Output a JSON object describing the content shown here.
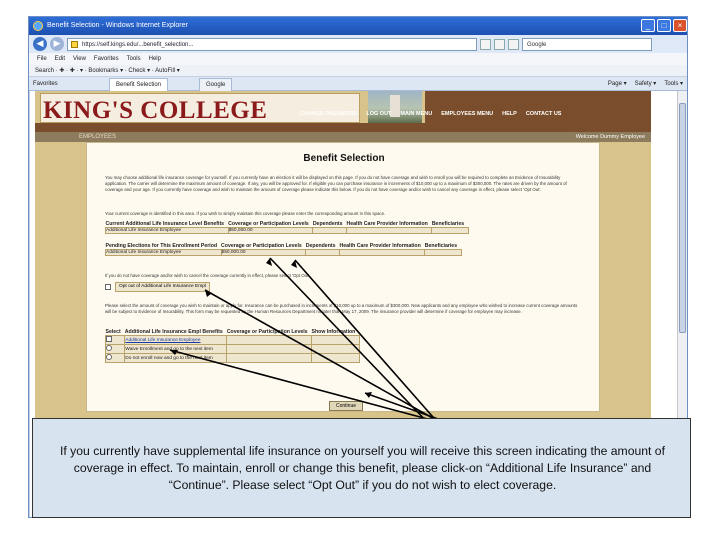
{
  "browser": {
    "title": "Benefit Selection - Windows Internet Explorer",
    "url": "https://self.kings.edu/...benefit_selection...",
    "search_placeholder": "Google",
    "menu": [
      "File",
      "Edit",
      "View",
      "Favorites",
      "Tools",
      "Help"
    ],
    "links_bar": "Search · ✚ · ✚ · ▾ · Bookmarks ▾ · Check ▾ · AutoFill ▾",
    "favorites_label": "Favorites",
    "tabs": [
      "Benefit Selection",
      "Google"
    ],
    "tool_items": [
      "Page ▾",
      "Safety ▾",
      "Tools ▾"
    ]
  },
  "site": {
    "logo": "KING'S COLLEGE",
    "nav": [
      "CHANGE PASSWORD",
      "LOG OUT",
      "MAIN MENU",
      "EMPLOYEES MENU",
      "HELP",
      "CONTACT US"
    ],
    "section": "EMPLOYEES",
    "welcome": "Welcome Dummy Employee"
  },
  "page": {
    "title": "Benefit Selection",
    "intro": "You may choose additional life insurance coverage for yourself. If you currently have an election it will be displayed on this page. If you do not have coverage and wish to enroll you will be required to complete an Evidence of Insurability application. The carrier will determine the maximum amount of coverage. If any, you will be approved for. If eligible you can purchase insurance in increments of $10,000 up to a maximum of $300,000. The rates are driven by the amount of coverage and your age. If you currently have coverage and wish to maintain the amount of coverage please indicate this below. If you do not have coverage and/or wish to cancel any coverage in effect, please select 'Opt Out'.",
    "current_note": "Your current coverage is identified in this area. If you wish to simply maintain this coverage please enter the corresponding amount in this space.",
    "current_table": {
      "headers": [
        "Current Additional Life Insurance Level Benefits",
        "Coverage or Participation Levels",
        "Dependents",
        "Health Care Provider Information",
        "Beneficiaries"
      ],
      "row": [
        "Additional Life Insurance Employee",
        "$50,000.00",
        "",
        "",
        ""
      ]
    },
    "pending_table": {
      "headers": [
        "Pending Elections for This Enrollment Period",
        "Coverage or Participation Levels",
        "Dependents",
        "Health Care Provider Information",
        "Beneficiaries"
      ],
      "row": [
        "Additional Life Insurance Employee",
        "$50,000.00",
        "",
        "",
        ""
      ]
    },
    "optout_note": "If you do not have coverage and/or wish to cancel the coverage currently in effect, please select 'Opt Out'.",
    "optout_label": "Opt out of Additional Life Insurance Empl",
    "select_note": "Please select the amount of coverage you wish to maintain or apply for. Insurance can be purchased in increments of $10,000 up to a maximum of $300,000. New applicants and any employee who wished to increase current coverage amounts will be subject to Evidence of Insurability. This form may be requested by the Human Resources Department no later than May 17, 2009. The insurance provider will determine if coverage for employee may increase.",
    "select_table": {
      "headers": [
        "Select",
        "Additional Life Insurance Empl Benefits",
        "Coverage or Participation Levels",
        "Show Information"
      ],
      "options": [
        "Additional Life Insurance Employee",
        "Waive Enrollment and go to the next item",
        "Do not enroll now and go to the next item"
      ]
    },
    "continue_label": "Continue"
  },
  "callout": {
    "text": "If you currently have supplemental life insurance on yourself you will receive this screen indicating the amount of coverage in effect.  To maintain, enroll or change this benefit, please click-on “Additional Life Insurance” and “Continue”.  Please select “Opt Out” if you do not wish to elect coverage."
  }
}
